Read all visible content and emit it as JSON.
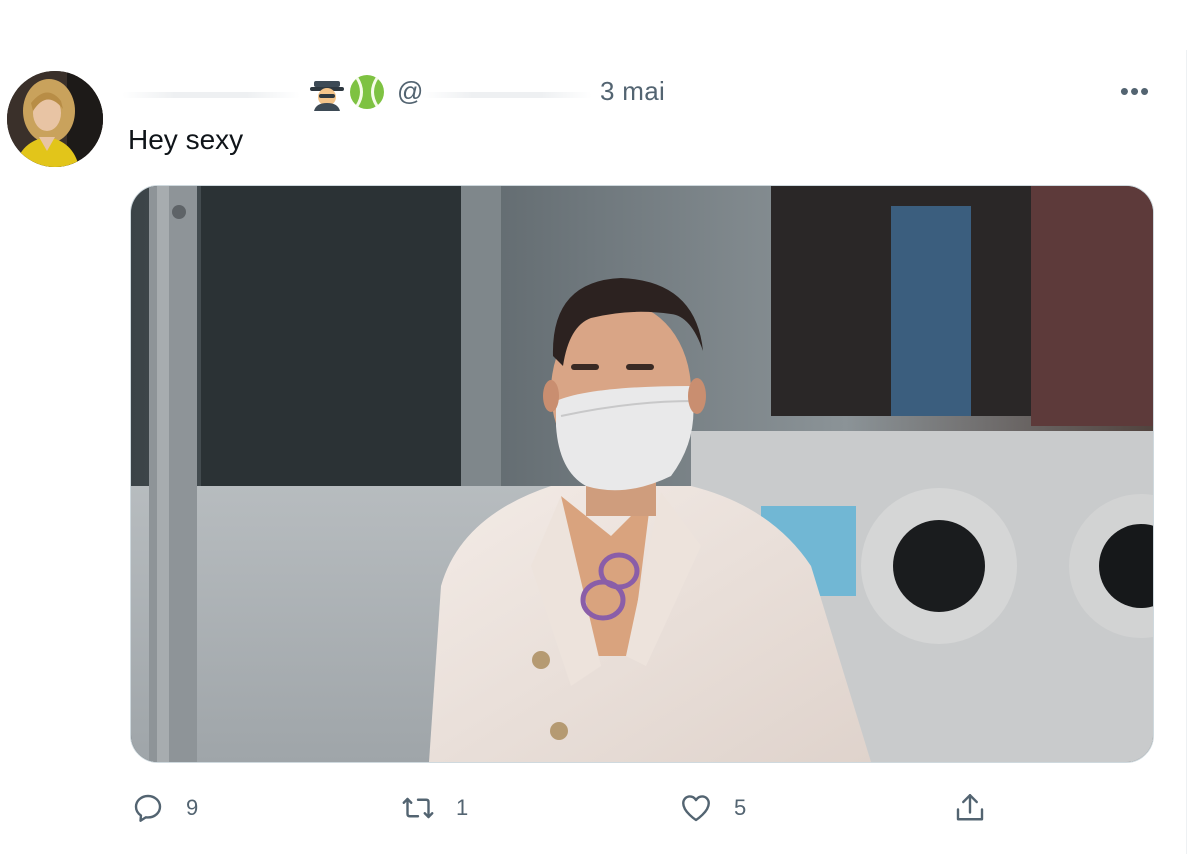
{
  "tweet": {
    "handle_prefix": "@",
    "date": "3 mai",
    "more_label": "•••",
    "text": "Hey sexy",
    "header_emojis": [
      "detective-emoji",
      "tennis-ball-emoji"
    ]
  },
  "actions": {
    "reply": {
      "icon": "reply-icon",
      "count": "9"
    },
    "retweet": {
      "icon": "retweet-icon",
      "count": "1"
    },
    "like": {
      "icon": "heart-icon",
      "count": "5"
    },
    "share": {
      "icon": "share-icon"
    }
  },
  "colors": {
    "text_primary": "#0f1419",
    "text_secondary": "#536471",
    "border": "#cfd9de"
  }
}
